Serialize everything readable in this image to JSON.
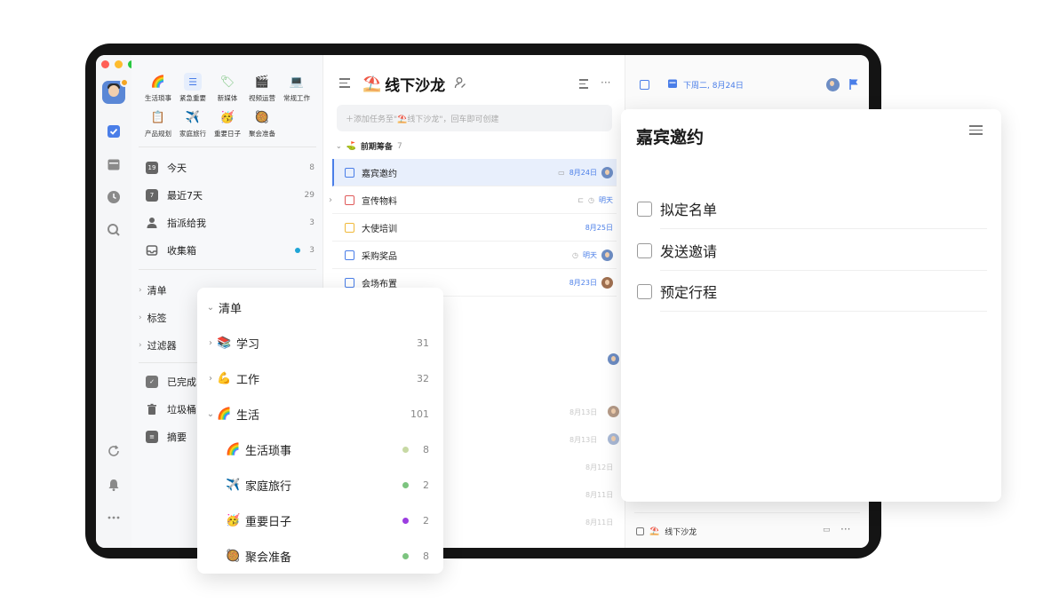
{
  "window_dots": [
    "#ff5f57",
    "#febc2e",
    "#28c840"
  ],
  "rail": {
    "icons": [
      "avatar-icon",
      "checkbox-icon",
      "calendar-icon",
      "clock-icon",
      "search-icon",
      "sync-icon",
      "bell-icon",
      "more-icon"
    ]
  },
  "shortcuts": [
    {
      "icon": "🌈",
      "label": "生活琐事"
    },
    {
      "icon": "☰",
      "label": "紧急重要"
    },
    {
      "icon": "🏷",
      "label": "新媒体"
    },
    {
      "icon": "🎬",
      "label": "视频运营"
    },
    {
      "icon": "💻",
      "label": "常规工作"
    },
    {
      "icon": "📋",
      "label": "产品规划"
    },
    {
      "icon": "✈️",
      "label": "家庭旅行"
    },
    {
      "icon": "🥳",
      "label": "重要日子"
    },
    {
      "icon": "🥘",
      "label": "聚会准备"
    }
  ],
  "smart_lists": [
    {
      "label": "今天",
      "count": "8",
      "icon_text": "19"
    },
    {
      "label": "最近7天",
      "count": "29",
      "icon_text": "7"
    },
    {
      "label": "指派给我",
      "count": "3",
      "icon_text": ""
    },
    {
      "label": "收集箱",
      "count": "3",
      "icon_text": ""
    }
  ],
  "groups": {
    "lists": "清单",
    "tags": "标签",
    "filters": "过滤器"
  },
  "bottom_lists": [
    {
      "label": "已完成"
    },
    {
      "label": "垃圾桶"
    },
    {
      "label": "摘要"
    }
  ],
  "task_list": {
    "emoji": "⛱️",
    "title": "线下沙龙",
    "add_placeholder": "＋添加任务至\"⛱️线下沙龙\"，回车即可创建",
    "section": {
      "name": "前期筹备",
      "count": "7",
      "emoji": "⛳"
    },
    "tasks": [
      {
        "title": "嘉宾邀约",
        "date": "8月24日",
        "color": "#4a7ee8"
      },
      {
        "title": "宣传物料",
        "date": "明天",
        "color": "#e05a5a"
      },
      {
        "title": "大使培训",
        "date": "8月25日",
        "color": "#f0b93a"
      },
      {
        "title": "采购奖品",
        "date": "明天",
        "color": "#4a7ee8"
      },
      {
        "title": "会场布置",
        "date": "8月23日",
        "color": "#4a7ee8"
      }
    ],
    "faded_dates": [
      "8月13日",
      "8月13日",
      "8月12日",
      "8月11日",
      "8月11日"
    ]
  },
  "detail": {
    "date": "下周二, 8月24日",
    "footer_list": "线下沙龙",
    "footer_emoji": "⛱️"
  },
  "detail_card": {
    "title": "嘉宾邀约",
    "subtasks": [
      "拟定名单",
      "发送邀请",
      "预定行程"
    ]
  },
  "list_popup": {
    "header": "清单",
    "items": [
      {
        "emoji": "📚",
        "label": "学习",
        "count": "31",
        "level": 0,
        "expanded": false
      },
      {
        "emoji": "💪",
        "label": "工作",
        "count": "32",
        "level": 0,
        "expanded": false
      },
      {
        "emoji": "🌈",
        "label": "生活",
        "count": "101",
        "level": 0,
        "expanded": true
      },
      {
        "emoji": "🌈",
        "label": "生活琐事",
        "count": "8",
        "level": 1,
        "dot": "#c7d9a4"
      },
      {
        "emoji": "✈️",
        "label": "家庭旅行",
        "count": "2",
        "level": 1,
        "dot": "#7cc47f"
      },
      {
        "emoji": "🥳",
        "label": "重要日子",
        "count": "2",
        "level": 1,
        "dot": "#9b3de0"
      },
      {
        "emoji": "🥘",
        "label": "聚会准备",
        "count": "8",
        "level": 1,
        "dot": "#7cc47f"
      }
    ]
  }
}
